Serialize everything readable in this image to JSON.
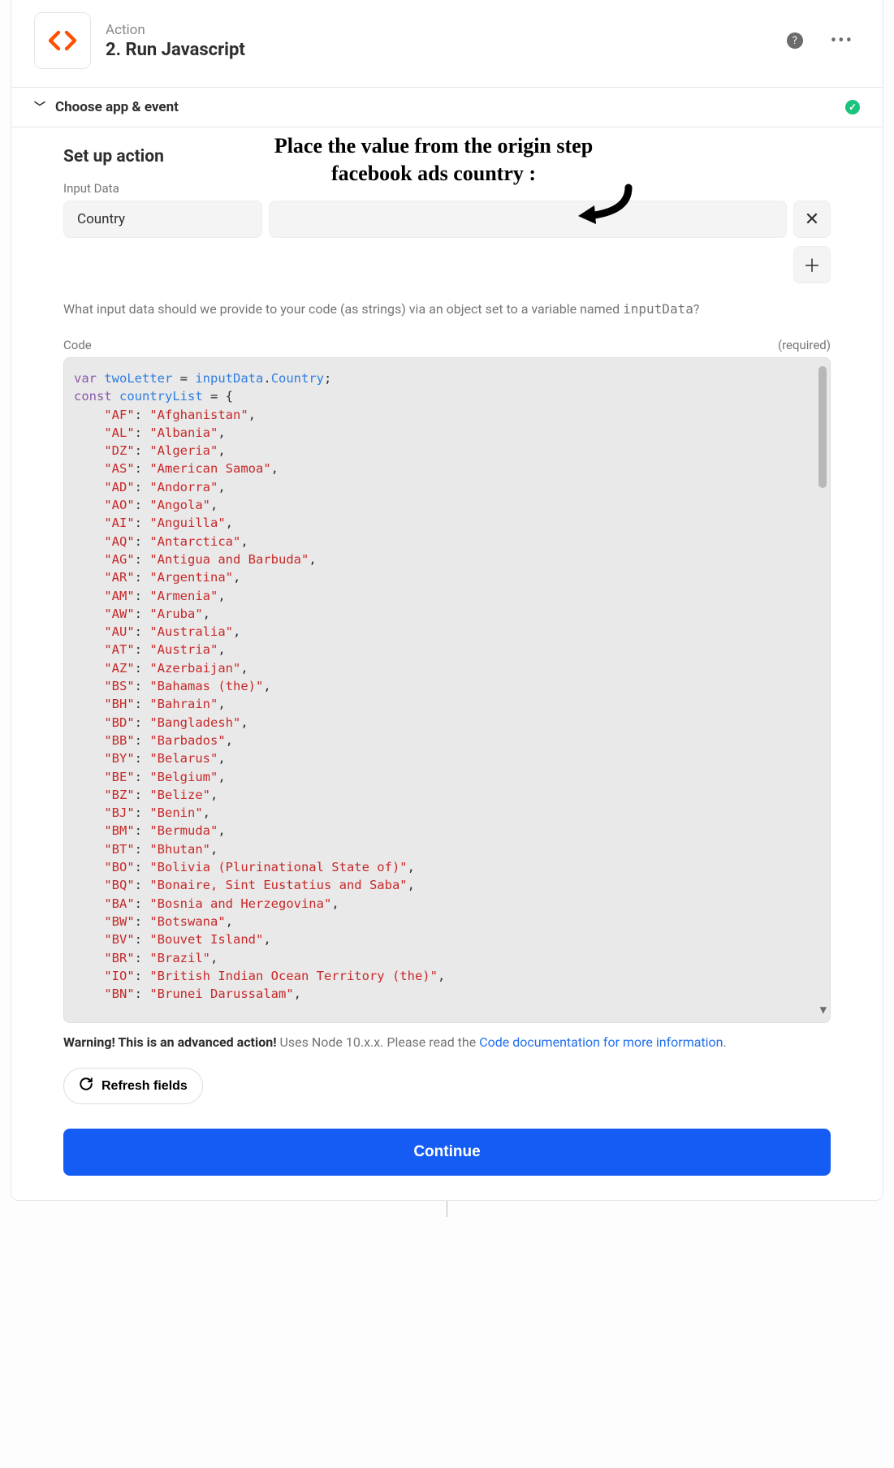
{
  "header": {
    "subtitle": "Action",
    "title": "2. Run Javascript"
  },
  "choose_section": {
    "label": "Choose app & event",
    "done": true
  },
  "setup": {
    "title": "Set up action",
    "input_data_label": "Input Data",
    "key_name": "Country",
    "hint_prefix": "What input data should we provide to your code (as strings) via an object set to a variable named ",
    "hint_var": "inputData",
    "hint_suffix": "?"
  },
  "annotation": {
    "line1": "Place the value from the origin step",
    "line2": "facebook ads country :"
  },
  "code": {
    "label": "Code",
    "required": "(required)",
    "header_line": {
      "var_kw": "var",
      "twoLetter": "twoLetter",
      "equals": " = ",
      "inputData": "inputData",
      "dot": ".",
      "Country": "Country",
      "semi": ";"
    },
    "const_line": {
      "const_kw": "const",
      "countryList": "countryList",
      "eqbrace": " = {"
    },
    "entries": [
      [
        "AF",
        "Afghanistan"
      ],
      [
        "AL",
        "Albania"
      ],
      [
        "DZ",
        "Algeria"
      ],
      [
        "AS",
        "American Samoa"
      ],
      [
        "AD",
        "Andorra"
      ],
      [
        "AO",
        "Angola"
      ],
      [
        "AI",
        "Anguilla"
      ],
      [
        "AQ",
        "Antarctica"
      ],
      [
        "AG",
        "Antigua and Barbuda"
      ],
      [
        "AR",
        "Argentina"
      ],
      [
        "AM",
        "Armenia"
      ],
      [
        "AW",
        "Aruba"
      ],
      [
        "AU",
        "Australia"
      ],
      [
        "AT",
        "Austria"
      ],
      [
        "AZ",
        "Azerbaijan"
      ],
      [
        "BS",
        "Bahamas (the)"
      ],
      [
        "BH",
        "Bahrain"
      ],
      [
        "BD",
        "Bangladesh"
      ],
      [
        "BB",
        "Barbados"
      ],
      [
        "BY",
        "Belarus"
      ],
      [
        "BE",
        "Belgium"
      ],
      [
        "BZ",
        "Belize"
      ],
      [
        "BJ",
        "Benin"
      ],
      [
        "BM",
        "Bermuda"
      ],
      [
        "BT",
        "Bhutan"
      ],
      [
        "BO",
        "Bolivia (Plurinational State of)"
      ],
      [
        "BQ",
        "Bonaire, Sint Eustatius and Saba"
      ],
      [
        "BA",
        "Bosnia and Herzegovina"
      ],
      [
        "BW",
        "Botswana"
      ],
      [
        "BV",
        "Bouvet Island"
      ],
      [
        "BR",
        "Brazil"
      ],
      [
        "IO",
        "British Indian Ocean Territory (the)"
      ],
      [
        "BN",
        "Brunei Darussalam"
      ]
    ]
  },
  "warning": {
    "bold": "Warning! This is an advanced action!",
    "text": " Uses Node 10.x.x. Please read the ",
    "link": "Code documentation for more information",
    "tail": "."
  },
  "buttons": {
    "refresh": "Refresh fields",
    "continue": "Continue"
  }
}
